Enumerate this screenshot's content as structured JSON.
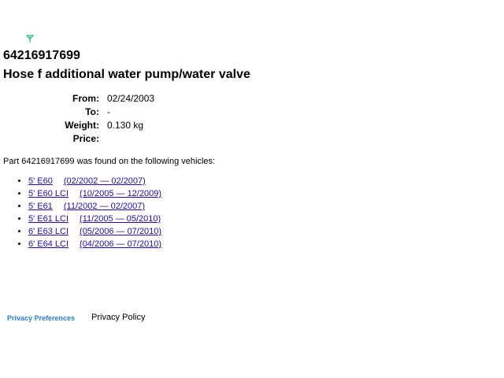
{
  "header": {
    "icon": "small-green-leaf-icon",
    "icon_color": "#2bbf7a"
  },
  "part": {
    "number": "64216917699",
    "title": "Hose f additional water pump/water valve"
  },
  "details": [
    {
      "label": "From:",
      "value": "02/24/2003"
    },
    {
      "label": "To:",
      "value": "-"
    },
    {
      "label": "Weight:",
      "value": "0.130 kg"
    },
    {
      "label": "Price:",
      "value": ""
    }
  ],
  "found_text": "Part 64216917699 was found on the following vehicles:",
  "vehicles": [
    {
      "model": "5' E60",
      "range": "(02/2002 — 02/2007)"
    },
    {
      "model": "5' E60 LCI",
      "range": "(10/2005 — 12/2009)"
    },
    {
      "model": "5' E61",
      "range": "(11/2002 — 02/2007)"
    },
    {
      "model": "5' E61 LCI",
      "range": "(11/2005 — 05/2010)"
    },
    {
      "model": "6' E63 LCI",
      "range": "(05/2006 — 07/2010)"
    },
    {
      "model": "6' E64 LCI",
      "range": "(04/2006 — 07/2010)"
    }
  ],
  "footer": {
    "privacy_preferences": "Privacy Preferences",
    "privacy_policy": "Privacy Policy",
    "privacy_preferences_color": "#2a7fd0"
  }
}
